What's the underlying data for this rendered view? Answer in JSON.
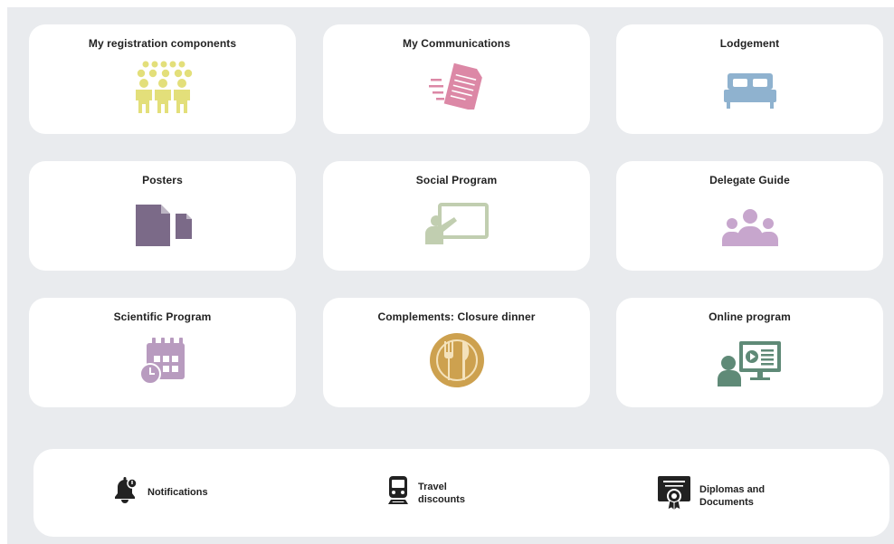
{
  "tiles": [
    {
      "label": "My registration components",
      "icon": "people-group-icon",
      "color": "#e3df7a"
    },
    {
      "label": "My Communications",
      "icon": "document-send-icon",
      "color": "#dc88a6"
    },
    {
      "label": "Lodgement",
      "icon": "bed-icon",
      "color": "#8fb2cf"
    },
    {
      "label": "Posters",
      "icon": "files-icon",
      "color": "#7b6a88"
    },
    {
      "label": "Social Program",
      "icon": "presenter-board-icon",
      "color": "#c1ceb0"
    },
    {
      "label": "Delegate Guide",
      "icon": "users-icon",
      "color": "#c7a6cd"
    },
    {
      "label": "Scientific Program",
      "icon": "calendar-clock-icon",
      "color": "#b89bbf"
    },
    {
      "label": "Complements: Closure dinner",
      "icon": "fork-knife-icon",
      "color": "#cda14f"
    },
    {
      "label": "Online program",
      "icon": "online-presentation-icon",
      "color": "#5f8a77"
    }
  ],
  "quick_links": [
    {
      "label": "Notifications",
      "icon": "bell-icon"
    },
    {
      "label": "Travel discounts",
      "icon": "train-icon"
    },
    {
      "label": "Diplomas and Documents",
      "icon": "certificate-icon"
    }
  ]
}
